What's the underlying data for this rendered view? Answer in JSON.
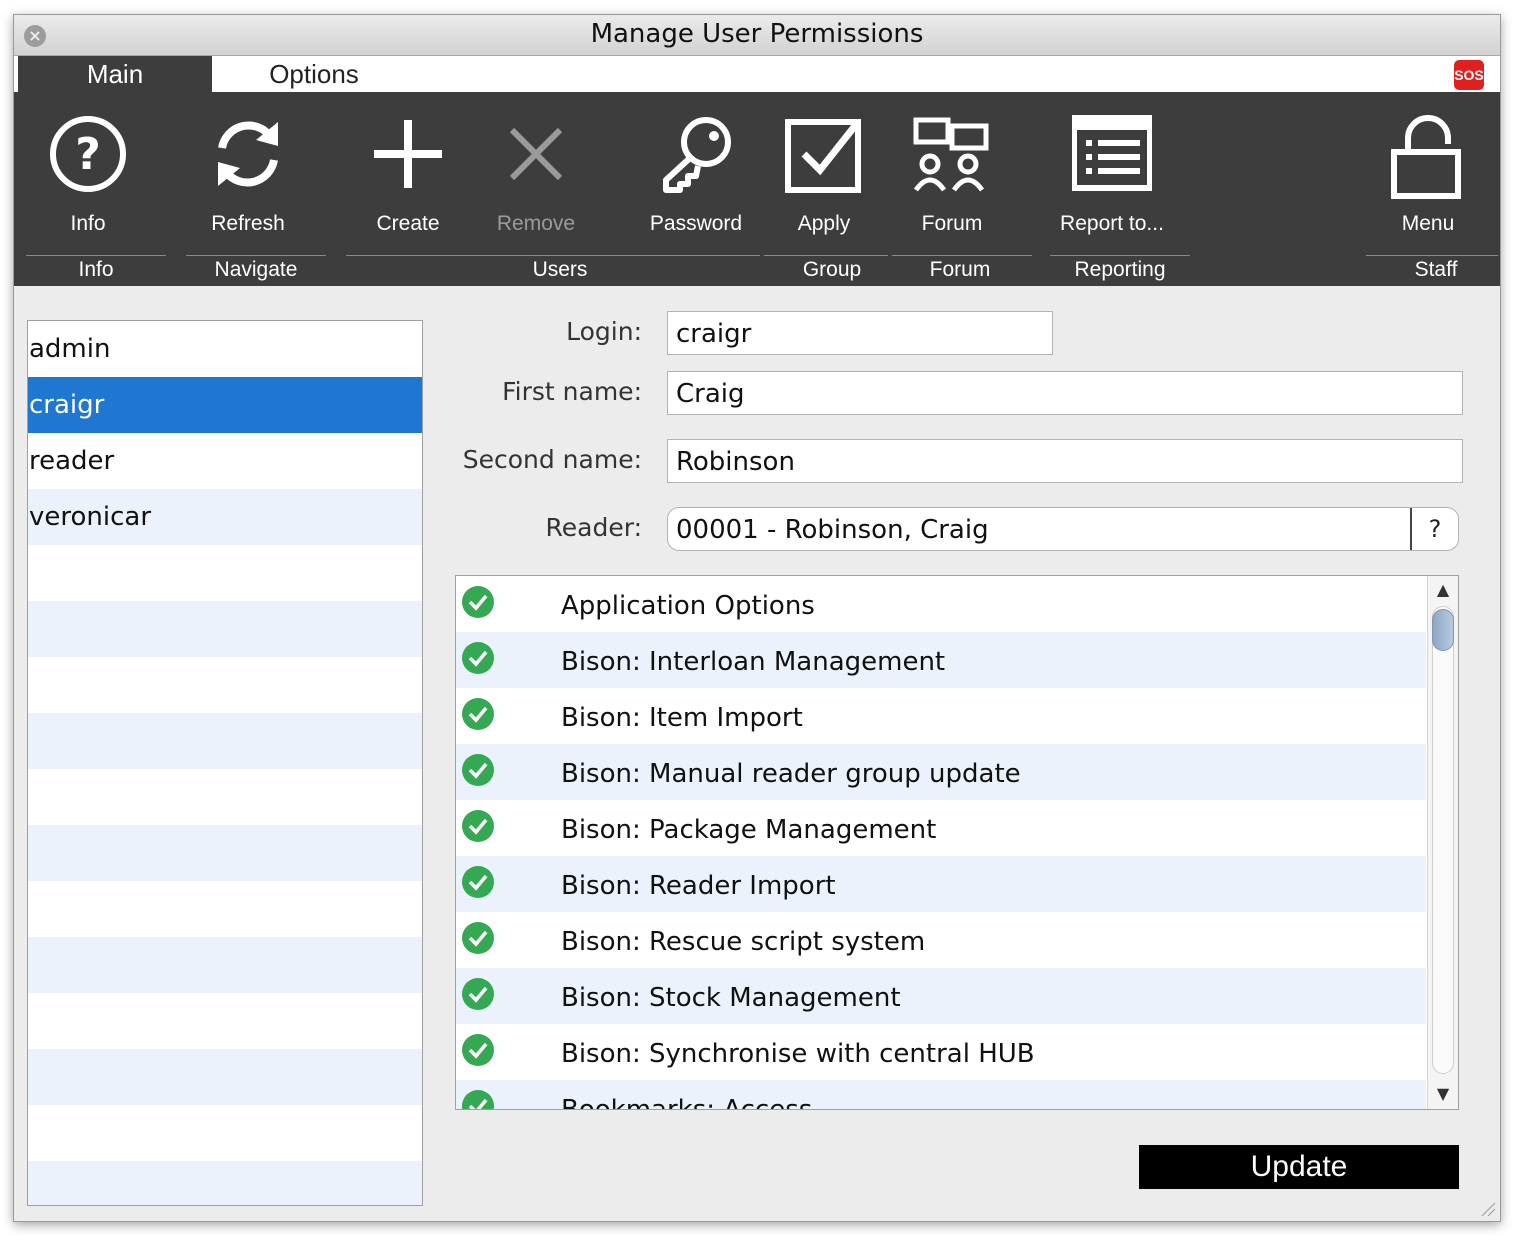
{
  "window": {
    "title": "Manage User Permissions"
  },
  "tabs": [
    {
      "label": "Main",
      "active": true
    },
    {
      "label": "Options",
      "active": false
    }
  ],
  "sos_label": "SOS",
  "toolbar": {
    "buttons": [
      {
        "label": "Info",
        "icon": "info-question-icon",
        "enabled": true
      },
      {
        "label": "Refresh",
        "icon": "refresh-icon",
        "enabled": true
      },
      {
        "label": "Create",
        "icon": "plus-icon",
        "enabled": true
      },
      {
        "label": "Remove",
        "icon": "x-icon",
        "enabled": false
      },
      {
        "label": "Password",
        "icon": "key-icon",
        "enabled": true
      },
      {
        "label": "Apply",
        "icon": "checkbox-icon",
        "enabled": true
      },
      {
        "label": "Forum",
        "icon": "forum-icon",
        "enabled": true
      },
      {
        "label": "Report to...",
        "icon": "report-icon",
        "enabled": true
      },
      {
        "label": "Menu",
        "icon": "unlock-icon",
        "enabled": true
      }
    ],
    "groups": [
      "Info",
      "Navigate",
      "Users",
      "Group",
      "Forum",
      "Reporting",
      "Staff"
    ]
  },
  "users": {
    "items": [
      "admin",
      "craigr",
      "reader",
      "veronicar"
    ],
    "selected": "craigr"
  },
  "form": {
    "login_label": "Login:",
    "login_value": "craigr",
    "first_name_label": "First name:",
    "first_name_value": "Craig",
    "second_name_label": "Second name:",
    "second_name_value": "Robinson",
    "reader_label": "Reader:",
    "reader_value": "00001 - Robinson, Craig",
    "reader_lookup_label": "?"
  },
  "permissions": [
    {
      "label": "Application Options",
      "granted": true
    },
    {
      "label": "Bison: Interloan Management",
      "granted": true
    },
    {
      "label": "Bison: Item Import",
      "granted": true
    },
    {
      "label": "Bison: Manual reader group update",
      "granted": true
    },
    {
      "label": "Bison: Package Management",
      "granted": true
    },
    {
      "label": "Bison: Reader Import",
      "granted": true
    },
    {
      "label": "Bison: Rescue script system",
      "granted": true
    },
    {
      "label": "Bison: Stock Management",
      "granted": true
    },
    {
      "label": "Bison: Synchronise with central HUB",
      "granted": true
    },
    {
      "label": "Bookmarks: Access",
      "granted": true
    }
  ],
  "update_label": "Update",
  "colors": {
    "toolbar_bg": "#3d3d3d",
    "selection": "#1f77d2",
    "row_alt": "#ebf2fc",
    "check_green": "#34a853",
    "sos_red": "#e02020"
  }
}
